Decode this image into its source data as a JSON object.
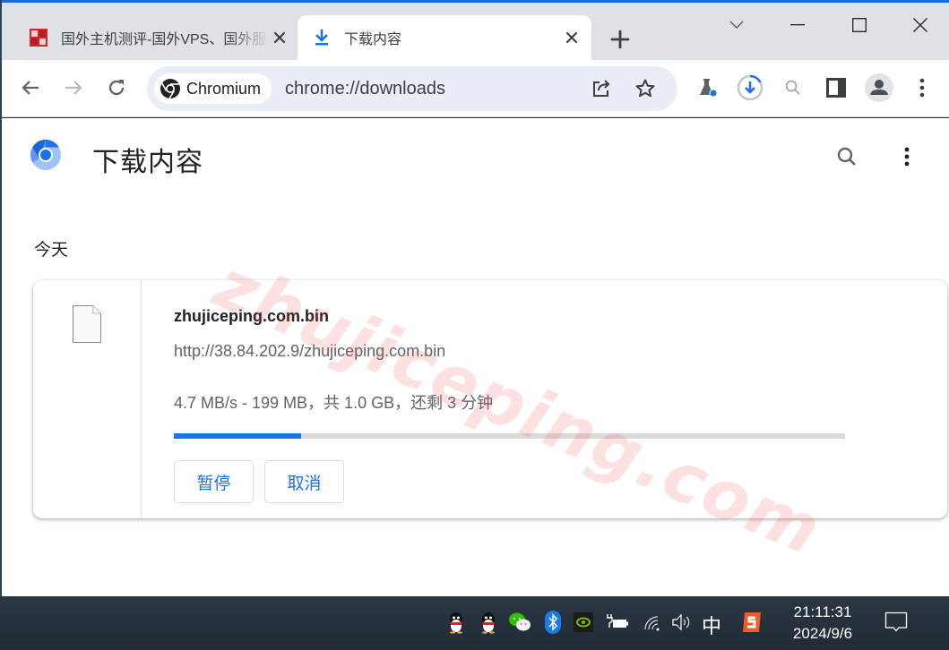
{
  "browser": {
    "tabs": [
      {
        "title": "国外主机测评-国外VPS、国外服务器",
        "favicon": "site-seal-icon",
        "active": false
      },
      {
        "title": "下载内容",
        "favicon": "download-icon",
        "active": true
      }
    ],
    "new_tab_label": "+",
    "window_controls": [
      "tab-search-chevron",
      "minimize",
      "maximize",
      "close"
    ]
  },
  "toolbar": {
    "chip_label": "Chromium",
    "url": "chrome://downloads",
    "icons": [
      "back-icon",
      "forward-icon",
      "reload-icon",
      "share-icon",
      "bookmark-star-icon",
      "labs-flask-icon",
      "download-progress-icon",
      "zoom-icon",
      "side-panel-icon",
      "profile-icon",
      "menu-icon"
    ]
  },
  "page": {
    "title": "下载内容",
    "section_label": "今天",
    "watermark": "zhujiceping.com",
    "download": {
      "file_name": "zhujiceping.com.bin",
      "url": "http://38.84.202.9/zhujiceping.com.bin",
      "status": "4.7 MB/s - 199 MB，共 1.0 GB，还剩 3 分钟",
      "progress_percent": 19,
      "pause_label": "暂停",
      "cancel_label": "取消"
    }
  },
  "taskbar": {
    "tray_icons": [
      "qq-icon",
      "qq-icon",
      "wechat-icon",
      "bluetooth-icon",
      "nvidia-icon",
      "battery-charging-icon",
      "wifi-icon",
      "volume-icon",
      "ime-indicator",
      "sogou-icon"
    ],
    "ime": "中",
    "time": "21:11:31",
    "date": "2024/9/6"
  },
  "colors": {
    "accent": "#1a73e8",
    "tabstrip": "#dee1e6",
    "omnibox": "#e9edf6",
    "taskbar": "#24313e"
  }
}
